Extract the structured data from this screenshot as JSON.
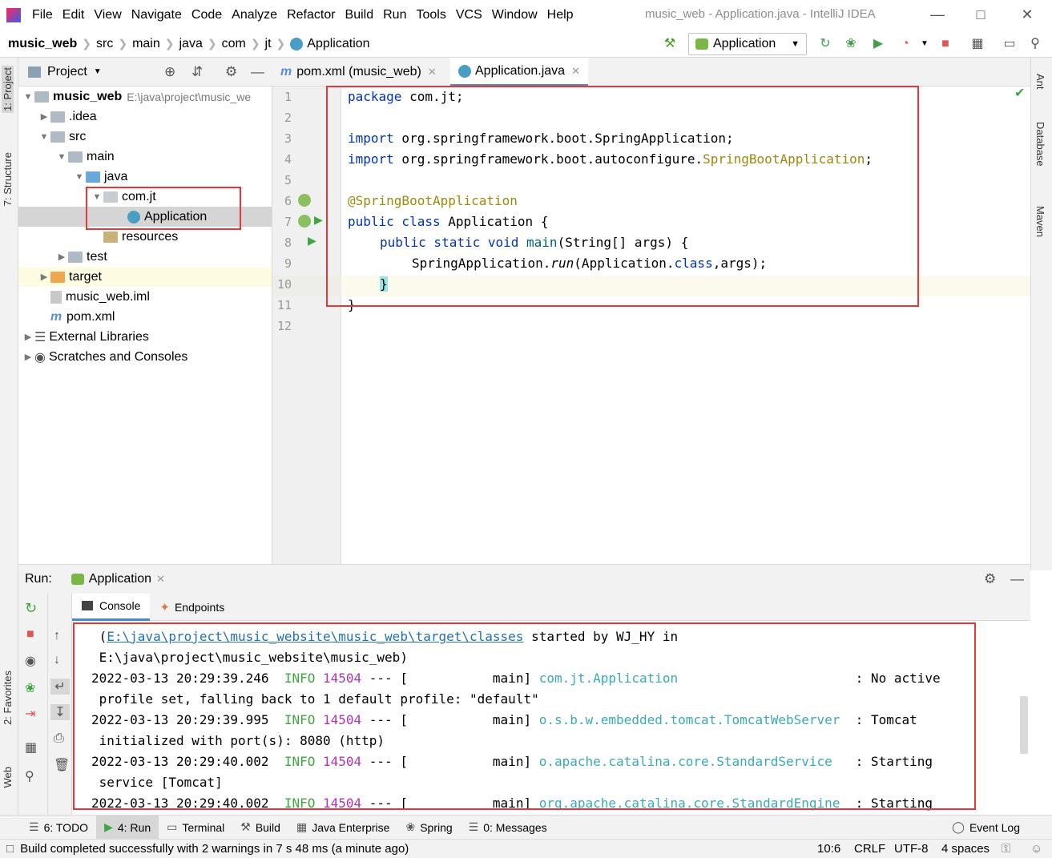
{
  "window": {
    "title": "music_web - Application.java - IntelliJ IDEA",
    "menu": [
      "File",
      "Edit",
      "View",
      "Navigate",
      "Code",
      "Analyze",
      "Refactor",
      "Build",
      "Run",
      "Tools",
      "VCS",
      "Window",
      "Help"
    ]
  },
  "breadcrumb": [
    "music_web",
    "src",
    "main",
    "java",
    "com",
    "jt",
    "Application"
  ],
  "run_config": "Application",
  "left_strip": {
    "project": "1: Project",
    "structure": "7: Structure",
    "favorites": "2: Favorites",
    "web": "Web"
  },
  "right_strip": {
    "ant": "Ant",
    "database": "Database",
    "maven": "Maven"
  },
  "project_panel": {
    "title": "Project",
    "tree": [
      {
        "label": "music_web",
        "extra": "E:\\java\\project\\music_we"
      },
      {
        "label": ".idea"
      },
      {
        "label": "src"
      },
      {
        "label": "main"
      },
      {
        "label": "java"
      },
      {
        "label": "com.jt"
      },
      {
        "label": "Application"
      },
      {
        "label": "resources"
      },
      {
        "label": "test"
      },
      {
        "label": "target"
      },
      {
        "label": "music_web.iml"
      },
      {
        "label": "pom.xml"
      },
      {
        "label": "External Libraries"
      },
      {
        "label": "Scratches and Consoles"
      }
    ]
  },
  "editor": {
    "tabs": [
      {
        "label": "pom.xml (music_web)"
      },
      {
        "label": "Application.java"
      }
    ],
    "line_numbers": [
      "1",
      "2",
      "3",
      "4",
      "5",
      "6",
      "7",
      "8",
      "9",
      "10",
      "11",
      "12"
    ],
    "code": {
      "l1a": "package",
      "l1b": " com.jt;",
      "l3a": "import",
      "l3b": " org.springframework.boot.SpringApplication;",
      "l4a": "import",
      "l4b": " org.springframework.boot.autoconfigure.",
      "l4c": "SpringBootApplication",
      "l4d": ";",
      "l6": "@SpringBootApplication",
      "l7a": "public class",
      "l7b": " Application {",
      "l8a": "public static void",
      "l8b": " ",
      "l8c": "main",
      "l8d": "(String[] args) {",
      "l9a": "SpringApplication.",
      "l9b": "run",
      "l9c": "(Application.",
      "l9d": "class",
      "l9e": ",args);",
      "l10": "}",
      "l11": "}"
    }
  },
  "run_panel": {
    "label": "Run:",
    "tab": "Application",
    "subtabs": [
      "Console",
      "Endpoints"
    ],
    "console": {
      "r1a": " (",
      "r1b": "E:\\java\\project\\music_website\\music_web\\target\\classes",
      "r1c": " started by WJ_HY in",
      "r2": " E:\\java\\project\\music_website\\music_web)",
      "r3a": "2022-03-13 20:29:39.246  ",
      "r3b": "INFO",
      "r3c": " 14504",
      "r3d": " --- [           main] ",
      "r3e": "com.jt.Application",
      "r3f": "                       : No active",
      "r4": " profile set, falling back to 1 default profile: \"default\"",
      "r5a": "2022-03-13 20:29:39.995  ",
      "r5b": "INFO",
      "r5c": " 14504",
      "r5d": " --- [           main] ",
      "r5e": "o.s.b.w.embedded.tomcat.TomcatWebServer",
      "r5f": "  : Tomcat",
      "r6": " initialized with port(s): 8080 (http)",
      "r7a": "2022-03-13 20:29:40.002  ",
      "r7b": "INFO",
      "r7c": " 14504",
      "r7d": " --- [           main] ",
      "r7e": "o.apache.catalina.core.StandardService",
      "r7f": "   : Starting",
      "r8": " service [Tomcat]",
      "r9a": "2022-03-13 20:29:40.002  ",
      "r9b": "INFO",
      "r9c": " 14504",
      "r9d": " --- [           main] ",
      "r9e": "org.apache.catalina.core.StandardEngine",
      "r9f": "  : Starting"
    }
  },
  "bottom_tabs": [
    "6: TODO",
    "4: Run",
    "Terminal",
    "Build",
    "Java Enterprise",
    "Spring",
    "0: Messages",
    "Event Log"
  ],
  "status": {
    "message": "Build completed successfully with 2 warnings in 7 s 48 ms (a minute ago)",
    "position": "10:6",
    "line_sep": "CRLF",
    "encoding": "UTF-8",
    "indent": "4 spaces"
  },
  "colors": {
    "accent": "#e53935",
    "keyword": "#0033b3",
    "annotation": "#9e880d",
    "info": "#3fa63f",
    "pid": "#b033b3",
    "logger": "#3aa9b8"
  }
}
